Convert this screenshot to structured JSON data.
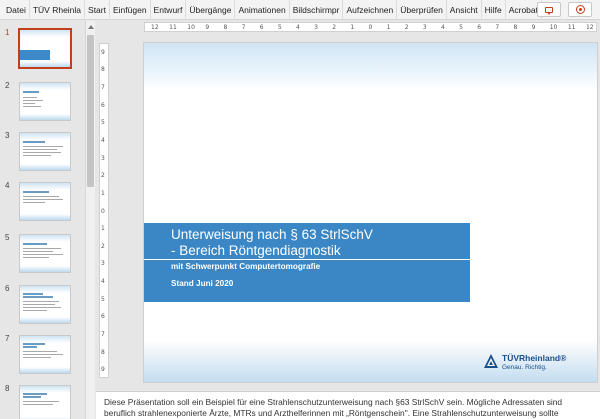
{
  "ribbon": {
    "tabs": [
      "Datei",
      "TÜV Rheinla",
      "Start",
      "Einfügen",
      "Entwurf",
      "Übergänge",
      "Animationen",
      "Bildschirmpr",
      "Aufzeichnen",
      "Überprüfen",
      "Ansicht",
      "Hilfe",
      "Acrobat"
    ],
    "comment_icon": "comment-icon",
    "record_icon": "record-icon",
    "accent_color": "#c43e1c"
  },
  "thumbnails": {
    "numbers": [
      "1",
      "2",
      "3",
      "4",
      "5",
      "6",
      "7",
      "8"
    ],
    "selected": "1"
  },
  "ruler": {
    "horizontal": [
      "12",
      "11",
      "10",
      "9",
      "8",
      "7",
      "6",
      "5",
      "4",
      "3",
      "2",
      "1",
      "0",
      "1",
      "2",
      "3",
      "4",
      "5",
      "6",
      "7",
      "8",
      "9",
      "10",
      "11",
      "12"
    ],
    "vertical": [
      "9",
      "8",
      "7",
      "6",
      "5",
      "4",
      "3",
      "2",
      "1",
      "0",
      "1",
      "2",
      "3",
      "4",
      "5",
      "6",
      "7",
      "8",
      "9"
    ]
  },
  "slide": {
    "title_line1": "Unterweisung nach § 63 StrlSchV",
    "title_line2": "- Bereich Röntgendiagnostik",
    "subtitle": "mit Schwerpunkt Computertomografie",
    "date": "Stand Juni 2020",
    "accent_color": "#3b87c6",
    "logo": {
      "brand": "TÜVRheinland®",
      "tagline": "Genau. Richtig."
    }
  },
  "notes": {
    "line1": "Diese Präsentation soll ein Beispiel für eine Strahlenschutzunterweisung nach §63 StrlSchV sein. Mögliche Adressaten sind",
    "line2": "beruflich strahlenexponierte Ärzte, MTRs und Arzthelferinnen mit „Röntgenschein\". Eine Strahlenschutzunterweisung sollte"
  }
}
